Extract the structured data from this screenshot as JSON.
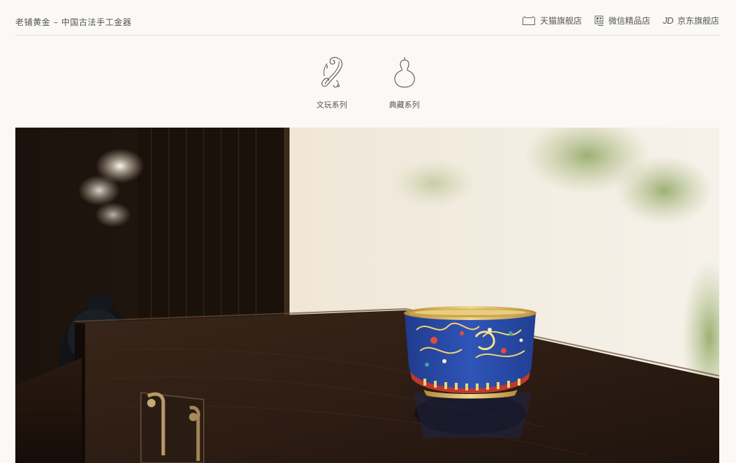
{
  "header": {
    "brand": "老铺黄金 – 中国古法手工金器",
    "stores": [
      {
        "label": "天猫旗舰店",
        "icon": "tmall-icon"
      },
      {
        "label": "微信精品店",
        "icon": "wechat-mini-icon"
      },
      {
        "label": "京东旗舰店",
        "icon": "jd-icon",
        "icon_text": "JD"
      }
    ]
  },
  "series": [
    {
      "label": "文玩系列",
      "icon": "ruyi-icon"
    },
    {
      "label": "典藏系列",
      "icon": "gourd-icon"
    }
  ],
  "hero": {
    "image": "cloisonne-gold-cup-photo",
    "colors": {
      "cup_enamel": "#2a4aa8",
      "cup_gold": "#d9b25a",
      "wood": "#2b1a12",
      "wall": "#f1ece2"
    }
  }
}
